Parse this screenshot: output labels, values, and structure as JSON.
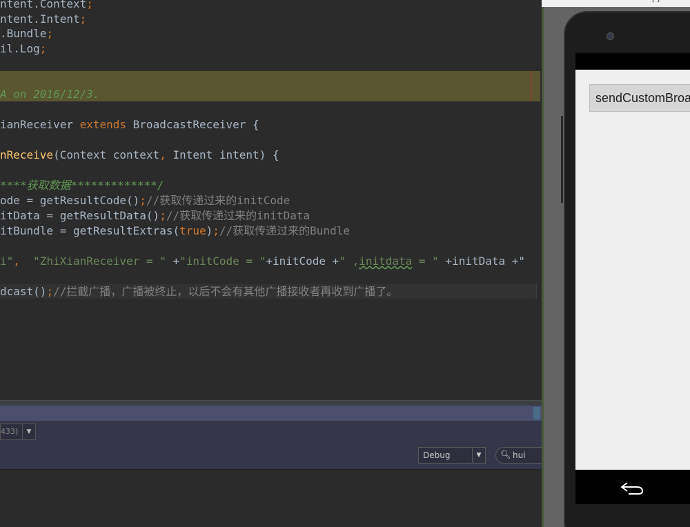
{
  "editor": {
    "lines": [
      {
        "segments": [
          {
            "t": "ntent.Context",
            "c": ""
          },
          {
            "t": ";",
            "c": "kw"
          }
        ]
      },
      {
        "segments": [
          {
            "t": "ntent.Intent",
            "c": ""
          },
          {
            "t": ";",
            "c": "kw"
          }
        ]
      },
      {
        "segments": [
          {
            "t": ".Bundle",
            "c": ""
          },
          {
            "t": ";",
            "c": "kw"
          }
        ]
      },
      {
        "segments": [
          {
            "t": "il.Log",
            "c": ""
          },
          {
            "t": ";",
            "c": "kw"
          }
        ]
      },
      {
        "segments": []
      },
      {
        "segments": []
      },
      {
        "segments": [
          {
            "t": "A on 2016/12/3.",
            "c": "doc"
          }
        ]
      },
      {
        "segments": []
      },
      {
        "segments": [
          {
            "t": "ianReceiver ",
            "c": ""
          },
          {
            "t": "extends",
            "c": "kw"
          },
          {
            "t": " BroadcastReceiver {",
            "c": ""
          }
        ]
      },
      {
        "segments": []
      },
      {
        "segments": [
          {
            "t": "nReceive",
            "c": "fn"
          },
          {
            "t": "(Context context",
            "c": ""
          },
          {
            "t": ",",
            "c": "kw"
          },
          {
            "t": " Intent intent) {",
            "c": ""
          }
        ]
      },
      {
        "segments": []
      },
      {
        "segments": [
          {
            "t": "****获取数据*************/",
            "c": "doc"
          }
        ]
      },
      {
        "segments": [
          {
            "t": "ode = getResultCode()",
            "c": ""
          },
          {
            "t": ";",
            "c": "kw"
          },
          {
            "t": "//获取传递过来的initCode",
            "c": "cm"
          }
        ]
      },
      {
        "segments": [
          {
            "t": "itData = getResultData()",
            "c": ""
          },
          {
            "t": ";",
            "c": "kw"
          },
          {
            "t": "//获取传递过来的initData",
            "c": "cm"
          }
        ]
      },
      {
        "segments": [
          {
            "t": "itBundle = getResultExtras(",
            "c": ""
          },
          {
            "t": "true",
            "c": "kw"
          },
          {
            "t": ")",
            "c": ""
          },
          {
            "t": ";",
            "c": "kw"
          },
          {
            "t": "//获取传递过来的Bundle",
            "c": "cm"
          }
        ]
      },
      {
        "segments": []
      },
      {
        "segments": [
          {
            "t": "i\"",
            "c": "str"
          },
          {
            "t": ",  ",
            "c": "kw"
          },
          {
            "t": "\"ZhiXianReceiver = \"",
            "c": "str"
          },
          {
            "t": " +",
            "c": ""
          },
          {
            "t": "\"initCode = \"",
            "c": "str"
          },
          {
            "t": "+initCode +",
            "c": ""
          },
          {
            "t": "\" ,",
            "c": "str"
          },
          {
            "t": "initdata",
            "c": "str wavy"
          },
          {
            "t": " = \"",
            "c": "str"
          },
          {
            "t": " +initData +\"",
            "c": ""
          }
        ]
      },
      {
        "segments": []
      },
      {
        "segments": [
          {
            "t": "dcast()",
            "c": ""
          },
          {
            "t": ";",
            "c": "kw"
          },
          {
            "t": "//拦截广播，广播被终止，以后不会有其他广播接收者再收到广播了。",
            "c": "cm"
          }
        ]
      }
    ]
  },
  "logcat": {
    "device_text": "433)",
    "level_value": "Debug",
    "search_value": "hui"
  },
  "emulator": {
    "app_button_label": "sendCustomBroa",
    "top_dots": "[ ]"
  }
}
